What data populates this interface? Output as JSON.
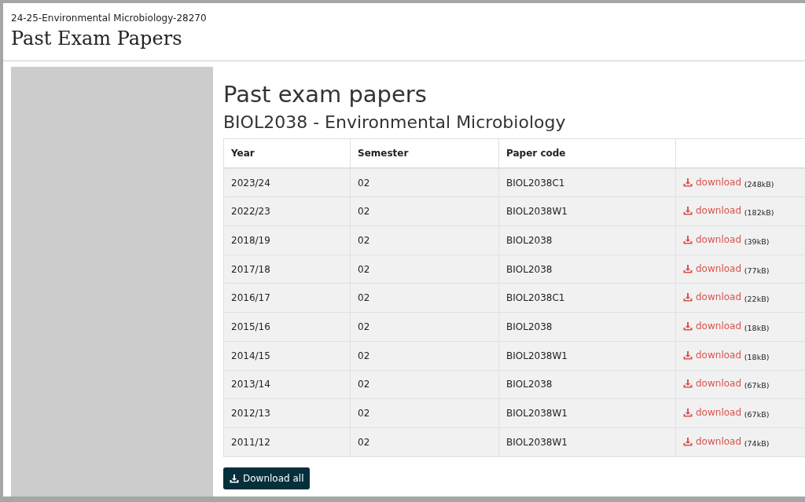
{
  "header": {
    "breadcrumb": "24-25-Environmental Microbiology-28270",
    "title": "Past Exam Papers"
  },
  "main": {
    "heading": "Past exam papers",
    "subheading": "BIOL2038 - Environmental Microbiology"
  },
  "table": {
    "columns": [
      "Year",
      "Semester",
      "Paper code"
    ],
    "rows": [
      {
        "year": "2023/24",
        "semester": "02",
        "code": "BIOL2038C1",
        "link": "download",
        "size": "(248kB)"
      },
      {
        "year": "2022/23",
        "semester": "02",
        "code": "BIOL2038W1",
        "link": "download",
        "size": "(182kB)"
      },
      {
        "year": "2018/19",
        "semester": "02",
        "code": "BIOL2038",
        "link": "download",
        "size": "(39kB)"
      },
      {
        "year": "2017/18",
        "semester": "02",
        "code": "BIOL2038",
        "link": "download",
        "size": "(77kB)"
      },
      {
        "year": "2016/17",
        "semester": "02",
        "code": "BIOL2038C1",
        "link": "download",
        "size": "(22kB)"
      },
      {
        "year": "2015/16",
        "semester": "02",
        "code": "BIOL2038",
        "link": "download",
        "size": "(18kB)"
      },
      {
        "year": "2014/15",
        "semester": "02",
        "code": "BIOL2038W1",
        "link": "download",
        "size": "(18kB)"
      },
      {
        "year": "2013/14",
        "semester": "02",
        "code": "BIOL2038",
        "link": "download",
        "size": "(67kB)"
      },
      {
        "year": "2012/13",
        "semester": "02",
        "code": "BIOL2038W1",
        "link": "download",
        "size": "(67kB)"
      },
      {
        "year": "2011/12",
        "semester": "02",
        "code": "BIOL2038W1",
        "link": "download",
        "size": "(74kB)"
      }
    ]
  },
  "download_all": "Download all"
}
